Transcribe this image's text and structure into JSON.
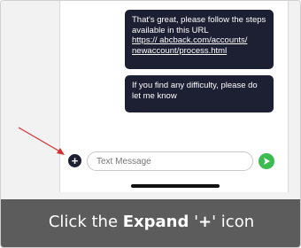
{
  "messages": [
    {
      "text": "That's great, please follow the steps available in this URL",
      "link": "https:// abcback.com/accounts/ newaccount/process.html"
    },
    {
      "text": "If you find any difficulty, please do let me know"
    }
  ],
  "composer": {
    "placeholder": "Text Message",
    "expand_icon": "plus-circle-icon",
    "send_icon": "send-arrow-icon"
  },
  "caption": {
    "prefix": "Click the ",
    "bold": "Expand",
    "middle": " '",
    "symbol": "+",
    "suffix": "' icon"
  },
  "colors": {
    "bubble": "#1d1f33",
    "send": "#3cbc50",
    "arrow": "#d32f2f",
    "caption_bg": "#5c5c5c"
  }
}
